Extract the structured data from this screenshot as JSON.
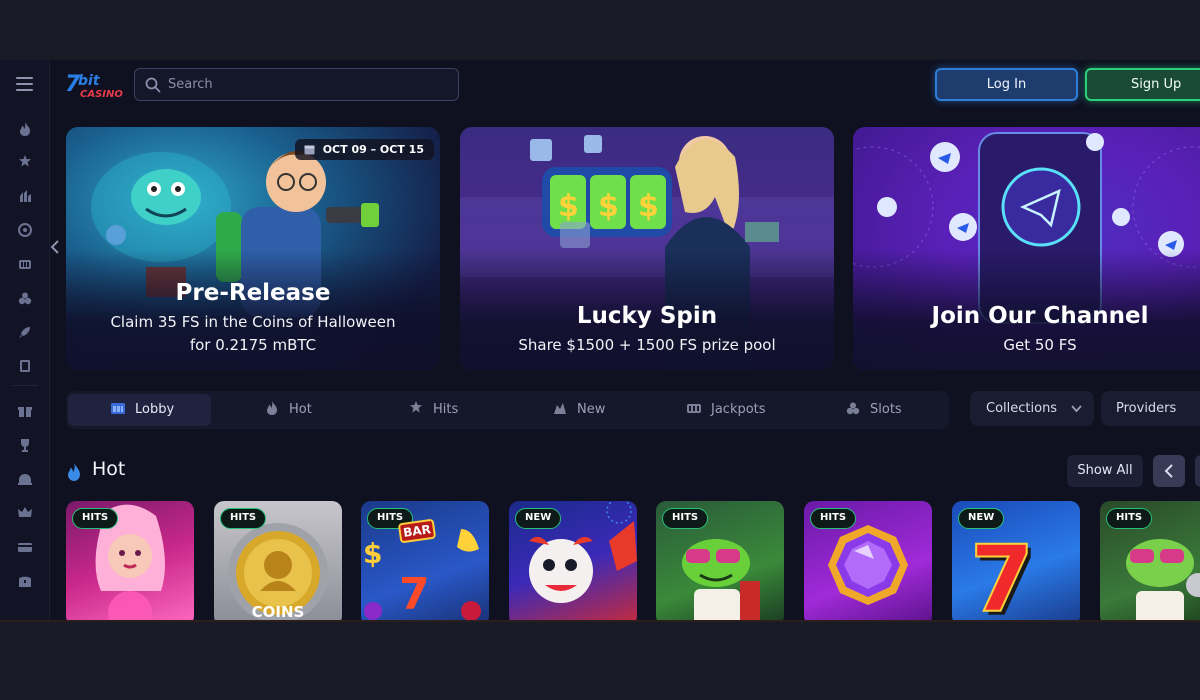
{
  "header": {
    "search_placeholder": "Search",
    "login_label": "Log In",
    "signup_label": "Sign Up",
    "colors": {
      "login": "#2f7fd8",
      "signup": "#2bd07a"
    }
  },
  "sidebar": {
    "icons": [
      "menu-icon",
      "fire-icon",
      "stars-icon",
      "hits-icon",
      "target-icon",
      "jackpot-icon",
      "cherries-icon",
      "rocket-icon",
      "cards-icon",
      "gift-icon",
      "trophy-icon",
      "vip-icon",
      "crown-icon",
      "wallet-icon",
      "chest-icon"
    ]
  },
  "banners": [
    {
      "date": "OCT 09 – OCT 15",
      "title": "Pre-Release",
      "sub1": "Claim 35 FS in the Coins of Halloween",
      "sub2": "for 0.2175 mBTC"
    },
    {
      "title": "Lucky Spin",
      "sub1": "Share $1500 + 1500 FS prize pool"
    },
    {
      "title": "Join Our Channel",
      "sub1": "Get 50 FS"
    }
  ],
  "tabs": [
    {
      "label": "Lobby",
      "icon": "lobby-icon"
    },
    {
      "label": "Hot",
      "icon": "fire-icon"
    },
    {
      "label": "Hits",
      "icon": "hits-icon"
    },
    {
      "label": "New",
      "icon": "new-icon"
    },
    {
      "label": "Jackpots",
      "icon": "jackpot-icon"
    },
    {
      "label": "Slots",
      "icon": "cherries-icon"
    }
  ],
  "filters": {
    "collections": "Collections",
    "providers": "Providers"
  },
  "hot": {
    "title": "Hot",
    "show_all": "Show All",
    "games": [
      {
        "badge": "HITS"
      },
      {
        "badge": "HITS",
        "art_text": "COINS"
      },
      {
        "badge": "HITS",
        "art_text": "BAR"
      },
      {
        "badge": "NEW"
      },
      {
        "badge": "HITS"
      },
      {
        "badge": "HITS"
      },
      {
        "badge": "NEW"
      },
      {
        "badge": "HITS"
      }
    ]
  }
}
